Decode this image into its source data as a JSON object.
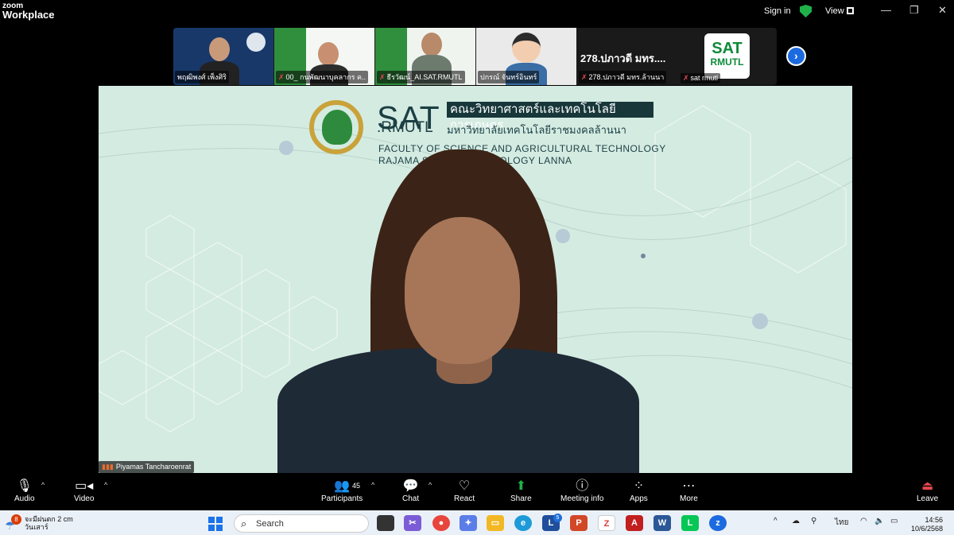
{
  "titlebar": {
    "brand_top": "zoom",
    "brand_bottom": "Workplace",
    "sign_in": "Sign in",
    "view": "View",
    "minimize": "—",
    "restore": "❐",
    "close": "✕"
  },
  "gallery": {
    "participants": [
      {
        "name": "พฤฒิพงศ์ เพ็งศิริ",
        "muted": false
      },
      {
        "name": "00_ กนพัฒนาบุคลากร ค..",
        "muted": true
      },
      {
        "name": "ธีรวัฒน์_AI.SAT.RMUTL",
        "muted": true
      },
      {
        "name": "ปกรณ์ จันทร์อินทร์",
        "muted": false
      },
      {
        "name": "278.ปภาวดี มทร.ล้านนา",
        "display": "278.ปภาวดี มทร....",
        "muted": true
      },
      {
        "name": "sat rmutl",
        "badge_top": "SAT",
        "badge_bottom": "RMUTL",
        "muted": true
      }
    ],
    "next_icon": "›"
  },
  "stage": {
    "speaker": "Piyamas Tancharoenrat",
    "logo": {
      "sat": "SAT",
      "rmutl": ".RMUTL",
      "thai_faculty": "คณะวิทยาศาสตร์และเทคโนโลยีการเกษตร",
      "thai_university": "มหาวิทยาลัยเทคโนโลยีราชมงคลล้านนา",
      "en_faculty": "FACULTY OF SCIENCE AND AGRICULTURAL TECHNOLOGY",
      "en_university": "RAJAMA          SITY OF TECHNOLOGY LANNA"
    }
  },
  "controls": {
    "audio": "Audio",
    "video": "Video",
    "participants": "Participants",
    "participant_count": "45",
    "chat": "Chat",
    "react": "React",
    "share": "Share",
    "meeting_info": "Meeting info",
    "apps": "Apps",
    "more": "More",
    "leave": "Leave"
  },
  "taskbar": {
    "weather_badge": "8",
    "weather_line1": "จะมีฝนตก 2 cm",
    "weather_line2": "วันเสาร์",
    "search_placeholder": "Search",
    "lang": "ไทย",
    "time": "14:56",
    "date": "10/6/2568",
    "badge_l": "5"
  },
  "colors": {
    "stage_bg": "#d4ebe2",
    "zoom_blue": "#1b6ae0",
    "share_green": "#1fb24a",
    "muted_red": "#e5484d"
  }
}
